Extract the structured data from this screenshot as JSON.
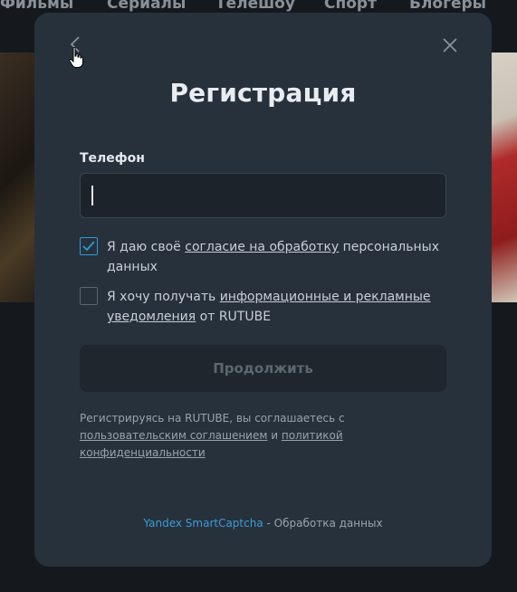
{
  "background_nav": {
    "items": [
      "Фильмы",
      "Сериалы",
      "Телешоу",
      "Спорт",
      "Блогеры"
    ]
  },
  "modal": {
    "title": "Регистрация",
    "back_icon": "chevron-left-icon",
    "close_icon": "close-icon",
    "phone": {
      "label": "Телефон",
      "value": "",
      "placeholder": ""
    },
    "consent": {
      "checked": true,
      "text_before": "Я даю своё ",
      "link": "согласие на обработку",
      "text_after": " персональных данных"
    },
    "marketing": {
      "checked": false,
      "text_before": "Я хочу получать ",
      "link": "информационные и рекламные уведомления",
      "text_after": " от RUTUBE"
    },
    "continue_label": "Продолжить",
    "terms": {
      "prefix": "Регистрируясь на RUTUBE, вы соглашаетесь с ",
      "link1": "пользовательским соглашением",
      "middle": " и ",
      "link2": "политикой конфиденциальности"
    },
    "captcha": {
      "brand": "Yandex SmartCaptcha",
      "separator": " - ",
      "data_link": "Обработка данных"
    }
  },
  "colors": {
    "modal_bg": "#27313b",
    "accent": "#2e9bd6",
    "captcha_link": "#3b9cd9"
  }
}
